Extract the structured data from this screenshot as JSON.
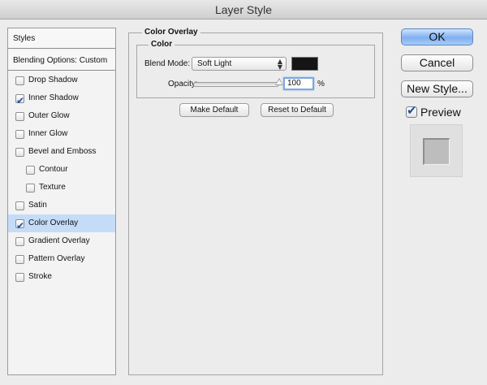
{
  "window": {
    "title": "Layer Style"
  },
  "styles_panel": {
    "header": "Styles",
    "blending_options": "Blending Options: Custom",
    "items": [
      {
        "label": "Drop Shadow",
        "checked": false,
        "indent": false,
        "selected": false
      },
      {
        "label": "Inner Shadow",
        "checked": true,
        "indent": false,
        "selected": false
      },
      {
        "label": "Outer Glow",
        "checked": false,
        "indent": false,
        "selected": false
      },
      {
        "label": "Inner Glow",
        "checked": false,
        "indent": false,
        "selected": false
      },
      {
        "label": "Bevel and Emboss",
        "checked": false,
        "indent": false,
        "selected": false
      },
      {
        "label": "Contour",
        "checked": false,
        "indent": true,
        "selected": false
      },
      {
        "label": "Texture",
        "checked": false,
        "indent": true,
        "selected": false
      },
      {
        "label": "Satin",
        "checked": false,
        "indent": false,
        "selected": false
      },
      {
        "label": "Color Overlay",
        "checked": true,
        "indent": false,
        "selected": true
      },
      {
        "label": "Gradient Overlay",
        "checked": false,
        "indent": false,
        "selected": false
      },
      {
        "label": "Pattern Overlay",
        "checked": false,
        "indent": false,
        "selected": false
      },
      {
        "label": "Stroke",
        "checked": false,
        "indent": false,
        "selected": false
      }
    ]
  },
  "color_overlay": {
    "section_title": "Color Overlay",
    "group_title": "Color",
    "blend_mode_label": "Blend Mode:",
    "blend_mode_value": "Soft Light",
    "overlay_color": "#151515",
    "opacity_label": "Opacity:",
    "opacity_value": "100",
    "opacity_unit": "%",
    "opacity_fraction": 1.0,
    "make_default": "Make Default",
    "reset_to_default": "Reset to Default"
  },
  "buttons": {
    "ok": "OK",
    "cancel": "Cancel",
    "new_style": "New Style..."
  },
  "preview": {
    "label": "Preview",
    "checked": true
  },
  "colors": {
    "selected_row": "#c5dcf8",
    "primary_button": "#7fb0ef",
    "checkmark": "#1d4fa3"
  }
}
